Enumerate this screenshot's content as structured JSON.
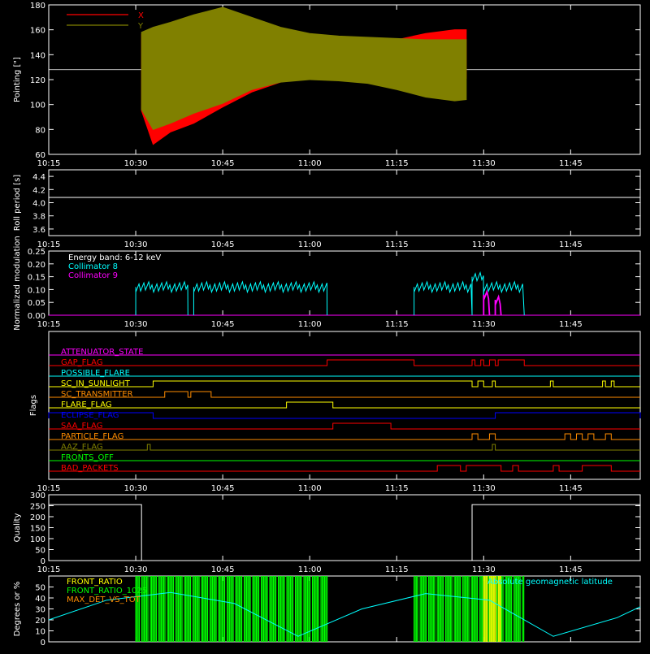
{
  "time_axis": {
    "start": "10:15",
    "end": "11:57",
    "ticks": [
      "10:15",
      "10:30",
      "10:45",
      "11:00",
      "11:15",
      "11:30",
      "11:45"
    ]
  },
  "chart_data": [
    {
      "type": "line",
      "id": "pointing",
      "ylabel": "Pointing [\"]",
      "ylim": [
        60,
        180
      ],
      "yticks": [
        60,
        80,
        100,
        120,
        140,
        160,
        180
      ],
      "reference_line": 128,
      "series": [
        {
          "name": "X",
          "color": "#ff0000",
          "x": [
            "10:31",
            "10:33",
            "10:36",
            "10:40",
            "10:45",
            "10:50",
            "10:55",
            "11:00",
            "11:05",
            "11:10",
            "11:15",
            "11:20",
            "11:25",
            "11:27"
          ],
          "upper": [
            156,
            150,
            148,
            145,
            140,
            138,
            137,
            137,
            140,
            146,
            152,
            157,
            160,
            160
          ],
          "lower": [
            95,
            68,
            78,
            85,
            98,
            110,
            118,
            122,
            124,
            123,
            122,
            120,
            120,
            121
          ]
        },
        {
          "name": "Y",
          "color": "#808000",
          "x": [
            "10:31",
            "10:33",
            "10:36",
            "10:40",
            "10:45",
            "10:50",
            "10:55",
            "11:00",
            "11:05",
            "11:10",
            "11:15",
            "11:20",
            "11:25",
            "11:27"
          ],
          "upper": [
            158,
            162,
            166,
            172,
            178,
            170,
            162,
            157,
            155,
            154,
            153,
            152,
            152,
            152
          ],
          "lower": [
            96,
            80,
            85,
            93,
            101,
            112,
            118,
            120,
            119,
            117,
            112,
            106,
            103,
            104
          ]
        }
      ]
    },
    {
      "type": "line",
      "id": "roll_period",
      "ylabel": "Roll period [s]",
      "ylim": [
        3.5,
        4.5
      ],
      "yticks": [
        3.6,
        3.8,
        4.0,
        4.2,
        4.4
      ],
      "series": [
        {
          "name": "",
          "color": "#ffffff",
          "x": [
            "10:15",
            "11:57"
          ],
          "values": [
            4.08,
            4.08
          ]
        }
      ]
    },
    {
      "type": "line",
      "id": "modulation",
      "ylabel": "Normalized modulation",
      "ylim": [
        0,
        0.25
      ],
      "yticks": [
        0.0,
        0.05,
        0.1,
        0.15,
        0.2,
        0.25
      ],
      "legend": [
        "Energy band: 6-12 keV",
        "Collimator 8",
        "Collimator 9"
      ],
      "legend_colors": [
        "#ffffff",
        "#00ffff",
        "#ff00ff"
      ],
      "series": [
        {
          "name": "Collimator 8",
          "color": "#00ffff",
          "segments": [
            [
              "10:30",
              "10:39",
              0.11
            ],
            [
              "10:40",
              "11:03",
              0.11
            ],
            [
              "11:18",
              "11:28",
              0.11
            ],
            [
              "11:28",
              "11:30",
              0.15
            ],
            [
              "11:30",
              "11:37",
              0.11
            ]
          ]
        },
        {
          "name": "Collimator 9",
          "color": "#ff00ff",
          "segments": [
            [
              "11:30",
              "11:31",
              0.08
            ],
            [
              "11:32",
              "11:33",
              0.06
            ]
          ]
        }
      ]
    },
    {
      "type": "table",
      "id": "flags",
      "ylabel": "Flags",
      "rows": [
        {
          "name": "ATTENUATOR_STATE",
          "color": "#ff00ff",
          "on": []
        },
        {
          "name": "GAP_FLAG",
          "color": "#ff0000",
          "on": [
            [
              "11:03",
              "11:18"
            ],
            [
              "11:28",
              "11:28.5"
            ],
            [
              "11:29.5",
              "11:30"
            ],
            [
              "11:31",
              "11:32"
            ],
            [
              "11:32.5",
              "11:37"
            ]
          ]
        },
        {
          "name": "POSSIBLE_FLARE",
          "color": "#00ffff",
          "on": []
        },
        {
          "name": "SC_IN_SUNLIGHT",
          "color": "#ffff00",
          "on": [
            [
              "10:33",
              "11:28"
            ],
            [
              "11:29",
              "11:30"
            ],
            [
              "11:31.5",
              "11:32"
            ],
            [
              "11:41.5",
              "11:42"
            ],
            [
              "11:50.5",
              "11:51"
            ],
            [
              "11:52",
              "11:52.5"
            ]
          ]
        },
        {
          "name": "SC_TRANSMITTER",
          "color": "#ff8c00",
          "on": [
            [
              "10:35",
              "10:39"
            ],
            [
              "10:39.5",
              "10:43"
            ]
          ]
        },
        {
          "name": "FLARE_FLAG",
          "color": "#ffff00",
          "on": [
            [
              "10:56",
              "11:04"
            ]
          ]
        },
        {
          "name": "ECLIPSE_FLAG",
          "color": "#0000ff",
          "on": [
            [
              "10:15",
              "10:33"
            ],
            [
              "11:32",
              "11:57"
            ]
          ]
        },
        {
          "name": "SAA_FLAG",
          "color": "#ff0000",
          "on": [
            [
              "11:04",
              "11:14"
            ]
          ]
        },
        {
          "name": "PARTICLE_FLAG",
          "color": "#ff8c00",
          "on": [
            [
              "11:28",
              "11:29"
            ],
            [
              "11:31",
              "11:32"
            ],
            [
              "11:44",
              "11:45"
            ],
            [
              "11:46",
              "11:47"
            ],
            [
              "11:48",
              "11:49"
            ],
            [
              "11:51",
              "11:52"
            ]
          ]
        },
        {
          "name": "AAZ_FLAG",
          "color": "#808000",
          "on": [
            [
              "10:32",
              "10:32.5"
            ],
            [
              "11:31.5",
              "11:32"
            ]
          ]
        },
        {
          "name": "FRONTS_OFF",
          "color": "#00ff00",
          "on": []
        },
        {
          "name": "BAD_PACKETS",
          "color": "#ff0000",
          "on": [
            [
              "11:22",
              "11:26"
            ],
            [
              "11:27",
              "11:33"
            ],
            [
              "11:35",
              "11:36"
            ],
            [
              "11:42",
              "11:43"
            ],
            [
              "11:47",
              "11:52"
            ]
          ]
        }
      ]
    },
    {
      "type": "line",
      "id": "quality",
      "ylabel": "Quality",
      "ylim": [
        0,
        300
      ],
      "yticks": [
        0,
        50,
        100,
        150,
        200,
        250,
        300
      ],
      "series": [
        {
          "name": "",
          "color": "#ffffff",
          "x": [
            "10:15",
            "10:31",
            "10:31",
            "11:28",
            "11:28",
            "11:57"
          ],
          "values": [
            255,
            255,
            0,
            0,
            255,
            255
          ]
        }
      ]
    },
    {
      "type": "line",
      "id": "degrees",
      "ylabel": "Degrees or %",
      "ylim": [
        0,
        60
      ],
      "yticks": [
        0,
        10,
        20,
        30,
        40,
        50
      ],
      "legend": [
        "FRONT_RATIO",
        "FRONT_RATIO_1025",
        "MAX_DET_VS_TOT"
      ],
      "legend_colors": [
        "#ffff00",
        "#00ff00",
        "#ff8c00"
      ],
      "right_label": "Absolute geomagnetic latitude",
      "series": [
        {
          "name": "FRONT_RATIO_1025",
          "color": "#00ff00",
          "segments": [
            [
              "10:30",
              "11:03"
            ],
            [
              "11:18",
              "11:37"
            ]
          ],
          "value": 60
        },
        {
          "name": "FRONT_RATIO",
          "color": "#ffff00",
          "segments": [
            [
              "11:30",
              "11:33"
            ]
          ],
          "value": 60
        },
        {
          "name": "Absolute geomagnetic latitude",
          "color": "#00ffff",
          "x": [
            "10:15",
            "10:25",
            "10:36",
            "10:47",
            "10:58",
            "11:09",
            "11:20",
            "11:31",
            "11:42",
            "11:53",
            "11:57"
          ],
          "values": [
            20,
            38,
            45,
            35,
            5,
            30,
            44,
            38,
            5,
            22,
            32
          ]
        }
      ]
    }
  ]
}
